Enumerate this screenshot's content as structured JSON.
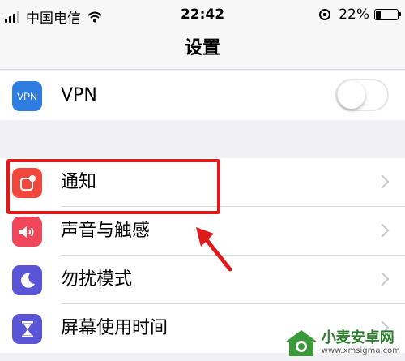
{
  "status_bar": {
    "carrier": "中国电信",
    "time": "22:42",
    "battery_percent": "22%",
    "battery_level": 0.22
  },
  "nav": {
    "title": "设置"
  },
  "settings": {
    "vpn": {
      "label": "VPN",
      "icon_text": "VPN",
      "icon_color": "#2f7de1",
      "toggle_on": false
    },
    "items": [
      {
        "label": "通知",
        "icon": "notification-icon",
        "icon_color": "#f0463c"
      },
      {
        "label": "声音与触感",
        "icon": "speaker-icon",
        "icon_color": "#f0465a"
      },
      {
        "label": "勿扰模式",
        "icon": "moon-icon",
        "icon_color": "#5a55d6"
      },
      {
        "label": "屏幕使用时间",
        "icon": "hourglass-icon",
        "icon_color": "#5a55d6"
      }
    ]
  },
  "annotation": {
    "highlight_color": "#e01a1a"
  },
  "watermark": {
    "title": "小麦安卓网",
    "url": "www.xmsigma.com"
  }
}
